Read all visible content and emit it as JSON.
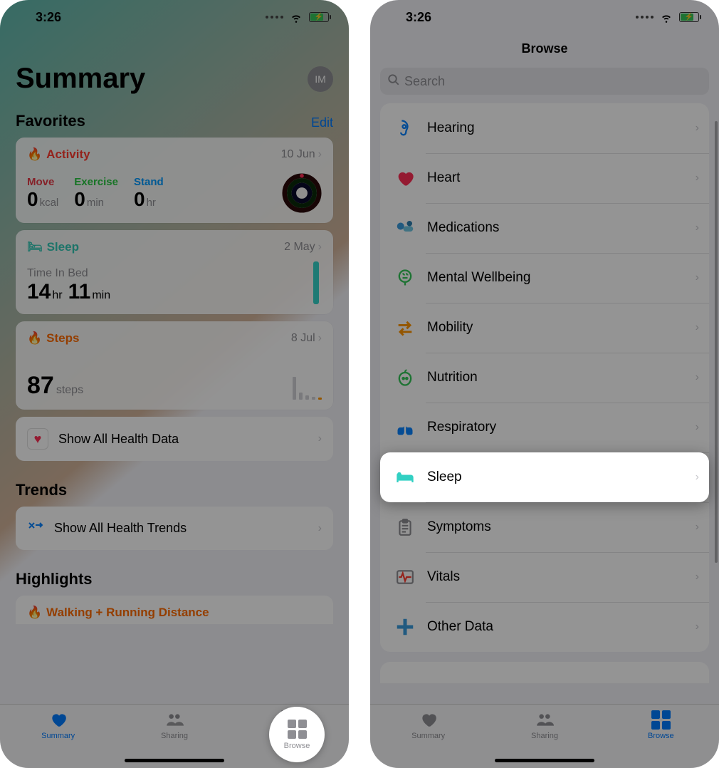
{
  "status": {
    "time": "3:26"
  },
  "left": {
    "title": "Summary",
    "avatar_initials": "IM",
    "favorites_label": "Favorites",
    "edit_label": "Edit",
    "activity": {
      "title": "Activity",
      "date": "10 Jun",
      "move_label": "Move",
      "move_val": "0",
      "move_unit": "kcal",
      "exercise_label": "Exercise",
      "exercise_val": "0",
      "exercise_unit": "min",
      "stand_label": "Stand",
      "stand_val": "0",
      "stand_unit": "hr"
    },
    "sleep": {
      "title": "Sleep",
      "date": "2 May",
      "sub": "Time In Bed",
      "hours": "14",
      "hours_unit": "hr",
      "mins": "11",
      "mins_unit": "min"
    },
    "steps": {
      "title": "Steps",
      "date": "8 Jul",
      "value": "87",
      "unit": "steps"
    },
    "show_all_data": "Show All Health Data",
    "trends_label": "Trends",
    "show_all_trends": "Show All Health Trends",
    "highlights_label": "Highlights",
    "walking": {
      "title": "Walking + Running Distance"
    },
    "tabs": {
      "summary": "Summary",
      "sharing": "Sharing",
      "browse": "Browse"
    }
  },
  "right": {
    "nav_title": "Browse",
    "search_placeholder": "Search",
    "categories": [
      {
        "name": "Hearing",
        "icon": "ear",
        "color": "#0a84ff"
      },
      {
        "name": "Heart",
        "icon": "heart",
        "color": "#ff2d55"
      },
      {
        "name": "Medications",
        "icon": "pills",
        "color": "#4aa7d6"
      },
      {
        "name": "Mental Wellbeing",
        "icon": "brain",
        "color": "#34c759"
      },
      {
        "name": "Mobility",
        "icon": "arrows",
        "color": "#ff9500"
      },
      {
        "name": "Nutrition",
        "icon": "apple",
        "color": "#34c759"
      },
      {
        "name": "Respiratory",
        "icon": "lungs",
        "color": "#0a84ff"
      },
      {
        "name": "Sleep",
        "icon": "bed",
        "color": "#32d0c3"
      },
      {
        "name": "Symptoms",
        "icon": "clipboard",
        "color": "#8e8e93"
      },
      {
        "name": "Vitals",
        "icon": "waveform",
        "color": "#ff3b30"
      },
      {
        "name": "Other Data",
        "icon": "plus",
        "color": "#3a9bdc"
      }
    ],
    "highlight_index": 7,
    "tabs": {
      "summary": "Summary",
      "sharing": "Sharing",
      "browse": "Browse"
    }
  }
}
